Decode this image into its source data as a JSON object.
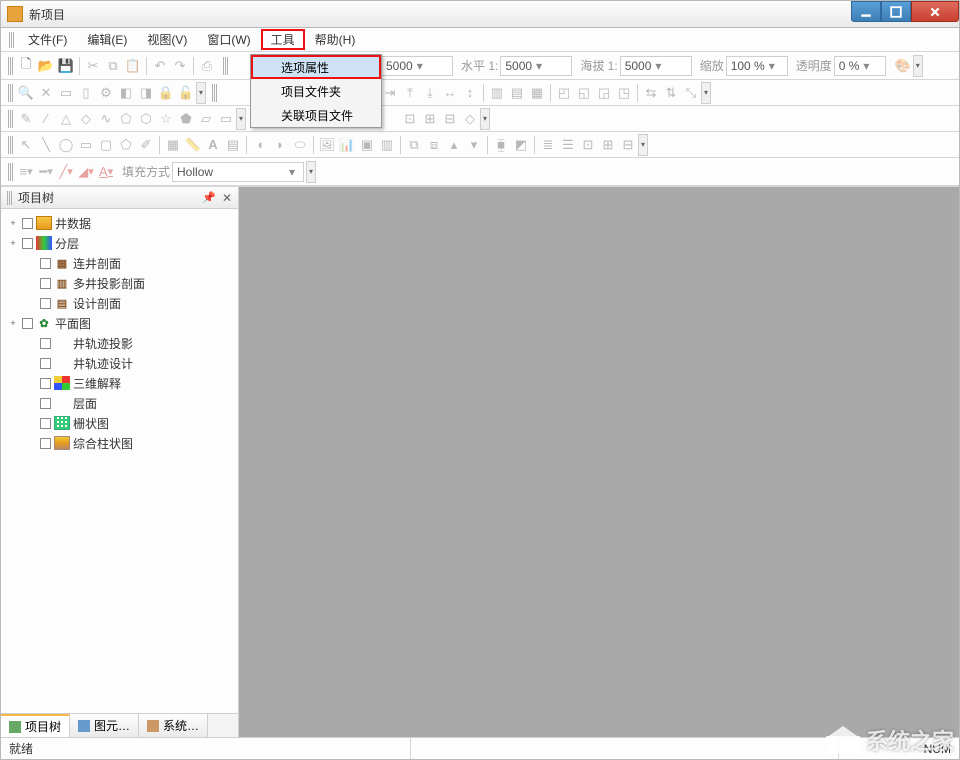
{
  "window": {
    "title": "新项目"
  },
  "menu": {
    "items": [
      {
        "label": "文件(F)"
      },
      {
        "label": "编辑(E)"
      },
      {
        "label": "视图(V)"
      },
      {
        "label": "窗口(W)"
      },
      {
        "label": "工具"
      },
      {
        "label": "帮助(H)"
      }
    ],
    "open_index": 4,
    "dropdown": [
      {
        "label": "选项属性",
        "highlight": true
      },
      {
        "label": "项目文件夹"
      },
      {
        "label": "关联项目文件"
      }
    ]
  },
  "toolbar1": {
    "combo_a": "5000",
    "h1_label": "水平 1:",
    "h1_value": "5000",
    "elev_label": "海拔 1:",
    "elev_value": "5000",
    "zoom_label": "缩放",
    "zoom_value": "100 %",
    "opacity_label": "透明度",
    "opacity_value": "0 %"
  },
  "toolbar5": {
    "fill_label": "填充方式",
    "fill_value": "Hollow"
  },
  "sidebar": {
    "title": "项目树",
    "items": [
      {
        "label": "井数据",
        "depth": 1,
        "expand": "+",
        "iconClass": "bar"
      },
      {
        "label": "分层",
        "depth": 1,
        "expand": "+",
        "iconClass": "lay"
      },
      {
        "label": "连井剖面",
        "depth": 2,
        "expand": "",
        "iconClass": "brown",
        "glyph": "▦"
      },
      {
        "label": "多井投影剖面",
        "depth": 2,
        "expand": "",
        "iconClass": "brown",
        "glyph": "▥"
      },
      {
        "label": "设计剖面",
        "depth": 2,
        "expand": "",
        "iconClass": "brown",
        "glyph": "▤"
      },
      {
        "label": "平面图",
        "depth": 1,
        "expand": "+",
        "iconClass": "green",
        "glyph": "✿"
      },
      {
        "label": "井轨迹投影",
        "depth": 2,
        "expand": "",
        "iconClass": "",
        "glyph": ""
      },
      {
        "label": "井轨迹设计",
        "depth": 2,
        "expand": "",
        "iconClass": "",
        "glyph": ""
      },
      {
        "label": "三维解释",
        "depth": 2,
        "expand": "",
        "iconClass": "cube"
      },
      {
        "label": "层面",
        "depth": 2,
        "expand": "",
        "iconClass": "",
        "glyph": ""
      },
      {
        "label": "栅状图",
        "depth": 2,
        "expand": "",
        "iconClass": "grid"
      },
      {
        "label": "综合柱状图",
        "depth": 2,
        "expand": "",
        "iconClass": "col"
      }
    ],
    "tabs": [
      {
        "label": "项目树",
        "active": true
      },
      {
        "label": "图元…"
      },
      {
        "label": "系统…"
      }
    ]
  },
  "status": {
    "ready": "就绪",
    "num": "NUM"
  },
  "watermark": "系统之家"
}
